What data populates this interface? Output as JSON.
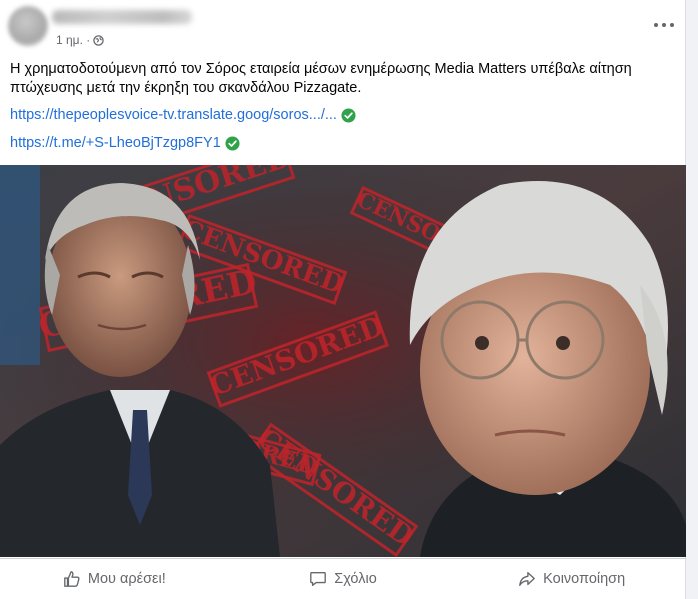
{
  "post": {
    "time": "1 ημ. ·",
    "text": "Η χρηματοδοτούμενη από τον Σόρος εταιρεία μέσων ενημέρωσης Media Matters υπέβαλε αίτηση πτώχευσης μετά την έκρηξη του σκανδάλου Pizzagate.",
    "links": [
      {
        "text": "https://thepeoplesvoice-tv.translate.goog/soros.../..."
      },
      {
        "text": "https://t.me/+S-LheoBjTzgp8FY1"
      }
    ],
    "image_stamps": [
      "CENSORED",
      "CENSORED",
      "CENSORED",
      "CENSORED",
      "CENSORED",
      "CENSORED",
      "CENSORED",
      "CENSORED"
    ]
  },
  "actions": {
    "like": "Μου αρέσει!",
    "comment": "Σχόλιο",
    "share": "Κοινοποίηση"
  },
  "colors": {
    "link": "#216fdb",
    "verified": "#31a24c",
    "stamp": "#c0242a",
    "muted": "#65676b"
  },
  "icons": [
    "globe-icon",
    "more-options-icon",
    "verified-check-icon",
    "thumbs-up-icon",
    "comment-icon",
    "share-icon"
  ]
}
